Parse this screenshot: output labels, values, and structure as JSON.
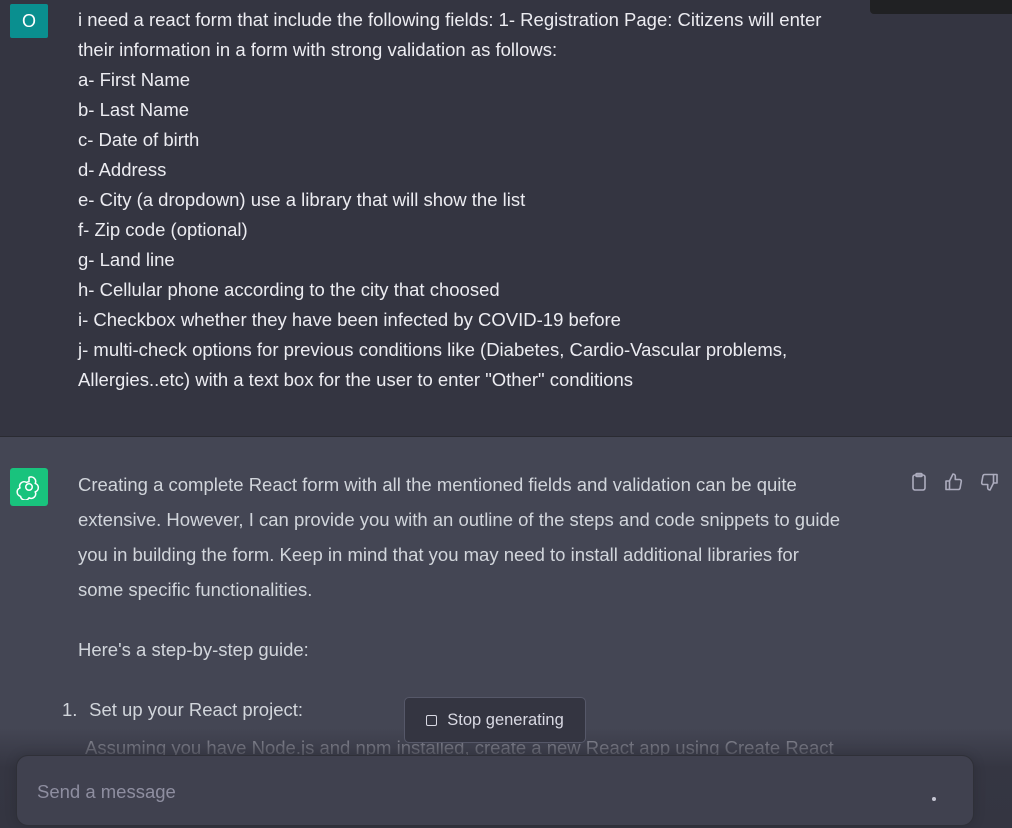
{
  "user_message": {
    "avatar_letter": "O",
    "avatar_color": "#0a8f8f",
    "lines": [
      "i need a react form that include the following fields: 1- Registration Page: Citizens will enter",
      "their information in a form with strong validation as follows:",
      "a- First Name",
      "b- Last Name",
      "c- Date of birth",
      "d- Address",
      "e- City (a dropdown) use a library that will show the list",
      "f- Zip code (optional)",
      "g- Land line",
      "h- Cellular phone according to the city that choosed",
      "i- Checkbox whether they have been infected by COVID-19 before",
      "j- multi-check options for previous conditions like (Diabetes, Cardio-Vascular problems,",
      "Allergies..etc) with a text box for the user to enter \"Other\" conditions"
    ]
  },
  "assistant_message": {
    "avatar_icon": "openai-logo-icon",
    "avatar_color": "#19c37d",
    "lines": [
      "Creating a complete React form with all the mentioned fields and validation can be quite",
      "extensive. However, I can provide you with an outline of the steps and code snippets to guide",
      "you in building the form. Keep in mind that you may need to install additional libraries for",
      "some specific functionalities."
    ],
    "guide_intro": "Here's a step-by-step guide:",
    "steps": [
      {
        "number": "1.",
        "title": "Set up your React project:",
        "detail": "Assuming you have Node.js and npm installed, create a new React app using Create React"
      }
    ],
    "actions": [
      "clipboard-icon",
      "thumbs-up-icon",
      "thumbs-down-icon"
    ]
  },
  "stop_button": {
    "label": "Stop generating",
    "icon": "stop-square-icon"
  },
  "composer": {
    "placeholder": "Send a message",
    "value": ""
  }
}
